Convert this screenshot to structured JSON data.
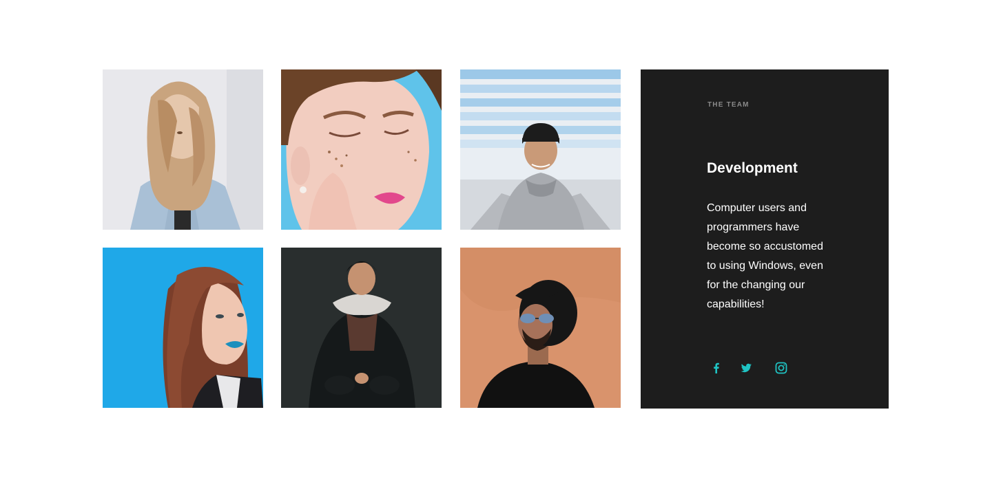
{
  "team_panel": {
    "eyebrow": "THE TEAM",
    "title": "Development",
    "description": "Computer users and programmers have become so accustomed to using Windows, even for the changing our capabilities!",
    "accent_color": "#1fc3c3",
    "background_color": "#1d1d1d",
    "socials": [
      {
        "icon": "facebook-icon"
      },
      {
        "icon": "twitter-icon"
      },
      {
        "icon": "instagram-icon"
      }
    ]
  },
  "photos": [
    {
      "icon": "portrait-photo"
    },
    {
      "icon": "portrait-photo"
    },
    {
      "icon": "portrait-photo"
    },
    {
      "icon": "portrait-photo"
    },
    {
      "icon": "portrait-photo"
    },
    {
      "icon": "portrait-photo"
    }
  ]
}
